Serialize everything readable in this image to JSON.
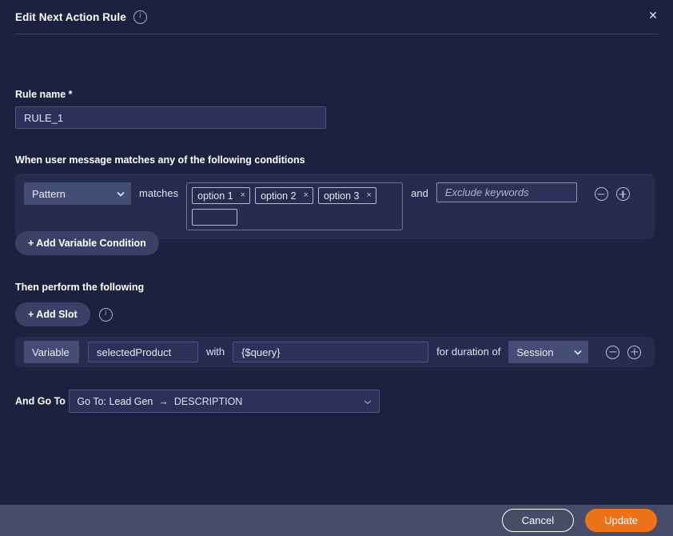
{
  "header": {
    "title": "Edit Next Action Rule",
    "info_icon": "info-icon",
    "close_icon": "✕"
  },
  "rule_name": {
    "label": "Rule name *",
    "value": "RULE_1",
    "placeholder": ""
  },
  "conditions": {
    "title": "When user message matches any of the following conditions",
    "match_type": "Pattern",
    "operator_label": "matches",
    "chips": [
      "option 1",
      "option 2",
      "option 3"
    ],
    "chip_remove_icon": "×",
    "chip_input_value": "",
    "chip_input_placeholder": "",
    "conjunction_label": "and",
    "exclude_value": "",
    "exclude_placeholder": "Exclude keywords",
    "remove_icon": "minus-circle-icon",
    "add_icon": "plus-circle-icon",
    "add_variable_condition_label": "+ Add Variable Condition"
  },
  "actions": {
    "title": "Then perform the following",
    "add_slot_label": "+ Add Slot",
    "info_icon": "info-icon",
    "slot": {
      "type": "Variable",
      "name": "selectedProduct",
      "with_label": "with",
      "value": "{$query}",
      "duration_label": "for duration of",
      "duration": "Session"
    }
  },
  "goto": {
    "label": "And Go To",
    "prefix": "Go To: Lead Gen",
    "arrow": "→",
    "target": "DESCRIPTION"
  },
  "footer": {
    "cancel_label": "Cancel",
    "update_label": "Update"
  },
  "colors": {
    "background": "#1c2140",
    "panel": "#262c4f",
    "input": "#2b3158",
    "select": "#464d74",
    "footer": "#474d69",
    "accent": "#ee7219",
    "text": "#e8ebf5"
  }
}
